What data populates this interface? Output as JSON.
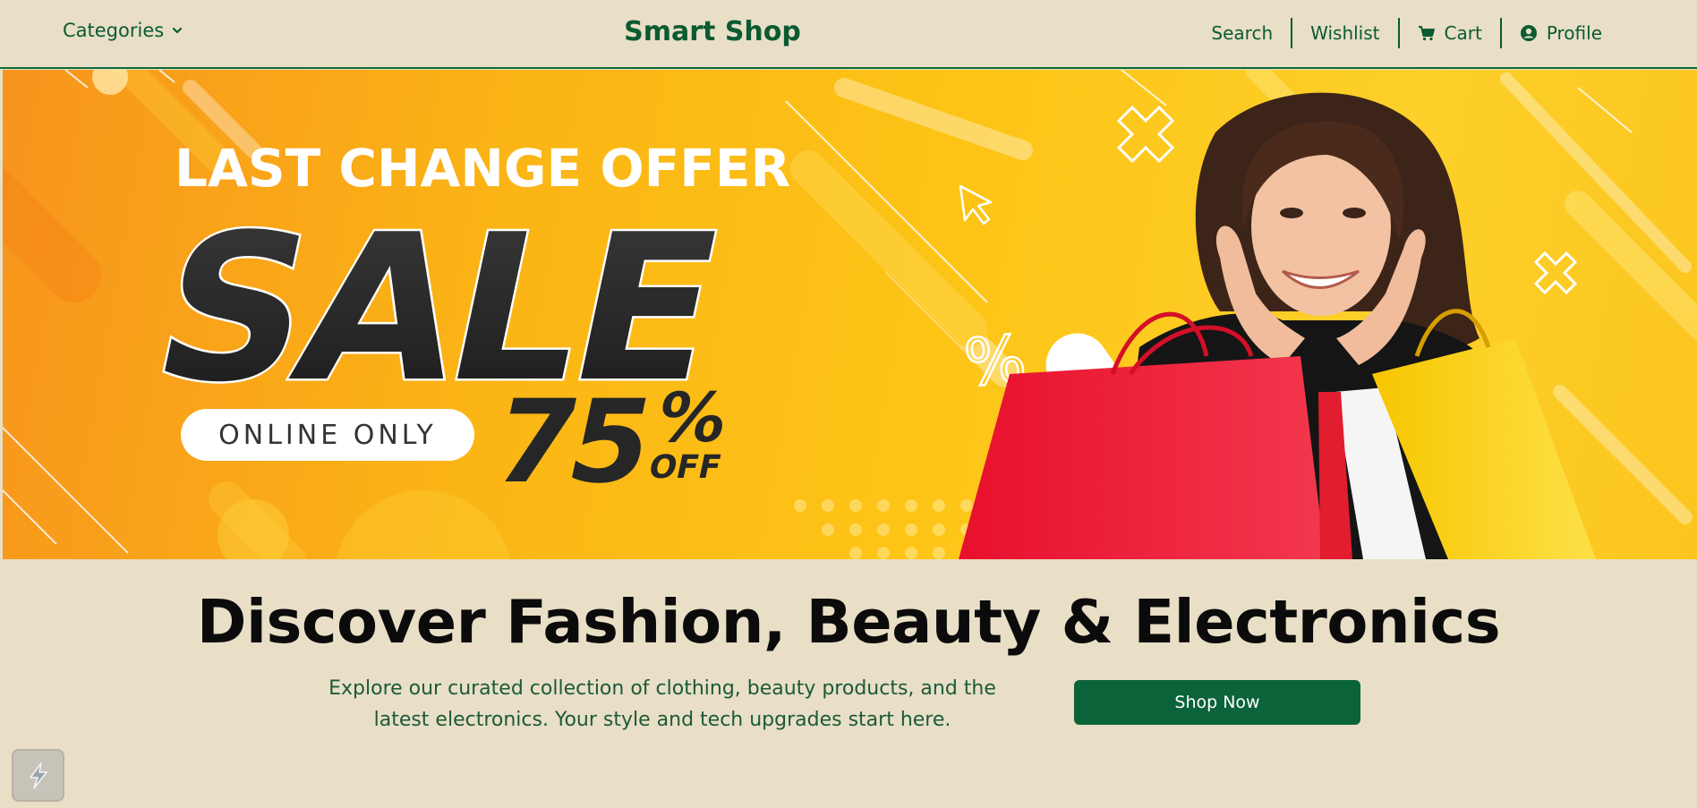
{
  "nav": {
    "categories_label": "Categories",
    "brand": "Smart Shop",
    "links": {
      "search": "Search",
      "wishlist": "Wishlist",
      "cart": "Cart",
      "profile": "Profile"
    }
  },
  "hero": {
    "offer_line": "LAST CHANGE OFFER",
    "sale_word": "SALE",
    "pill_text": "ONLINE ONLY",
    "discount_value": "75",
    "discount_percent": "%",
    "discount_off": "OFF",
    "percent_deco": "%"
  },
  "main": {
    "headline": "Discover Fashion, Beauty & Electronics",
    "subtext": "Explore our curated collection of clothing, beauty products, and the latest electronics. Your style and tech upgrades start here.",
    "cta_label": "Shop Now"
  },
  "colors": {
    "background": "#e8dfc6",
    "brand_green": "#0b5a32",
    "button_green": "#0b6339",
    "banner_yellow": "#fdc416"
  },
  "icons": {
    "categories": "chevron-down-icon",
    "cart": "cart-icon",
    "profile": "user-circle-icon",
    "widget": "lightning-icon"
  }
}
